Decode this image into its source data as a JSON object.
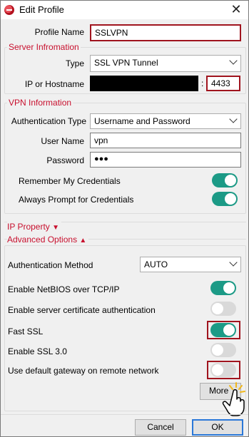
{
  "window": {
    "title": "Edit Profile",
    "close": "✕"
  },
  "profile": {
    "label": "Profile Name",
    "value": "SSLVPN"
  },
  "server": {
    "group_title": "Server Infromation",
    "type_label": "Type",
    "type_value": "SSL VPN Tunnel",
    "host_label": "IP or Hostname",
    "colon": ":",
    "port_value": "4433"
  },
  "vpn": {
    "group_title": "VPN Information",
    "auth_type_label": "Authentication Type",
    "auth_type_value": "Username and Password",
    "user_label": "User Name",
    "user_value": "vpn",
    "password_label": "Password",
    "password_value": "●●●",
    "remember_label": "Remember My Credentials",
    "remember_on": true,
    "prompt_label": "Always Prompt for Credentials",
    "prompt_on": true
  },
  "ip_property": {
    "label": "IP Property",
    "arrow": "▼"
  },
  "advanced": {
    "label": "Advanced Options",
    "arrow": "▲",
    "auth_method_label": "Authentication Method",
    "auth_method_value": "AUTO",
    "items": [
      {
        "label": "Enable NetBIOS over TCP/IP",
        "on": true
      },
      {
        "label": "Enable server certificate authentication",
        "on": false
      },
      {
        "label": "Fast SSL",
        "on": true
      },
      {
        "label": "Enable SSL 3.0",
        "on": false
      },
      {
        "label": "Use default gateway on remote network",
        "on": false
      }
    ],
    "more_label": "More"
  },
  "footer": {
    "cancel_label": "Cancel",
    "ok_label": "OK"
  },
  "colors": {
    "accent": "#c8102e",
    "toggle_on": "#1c9a86",
    "toggle_off": "#d9d9d9",
    "highlight": "#a0141e"
  }
}
